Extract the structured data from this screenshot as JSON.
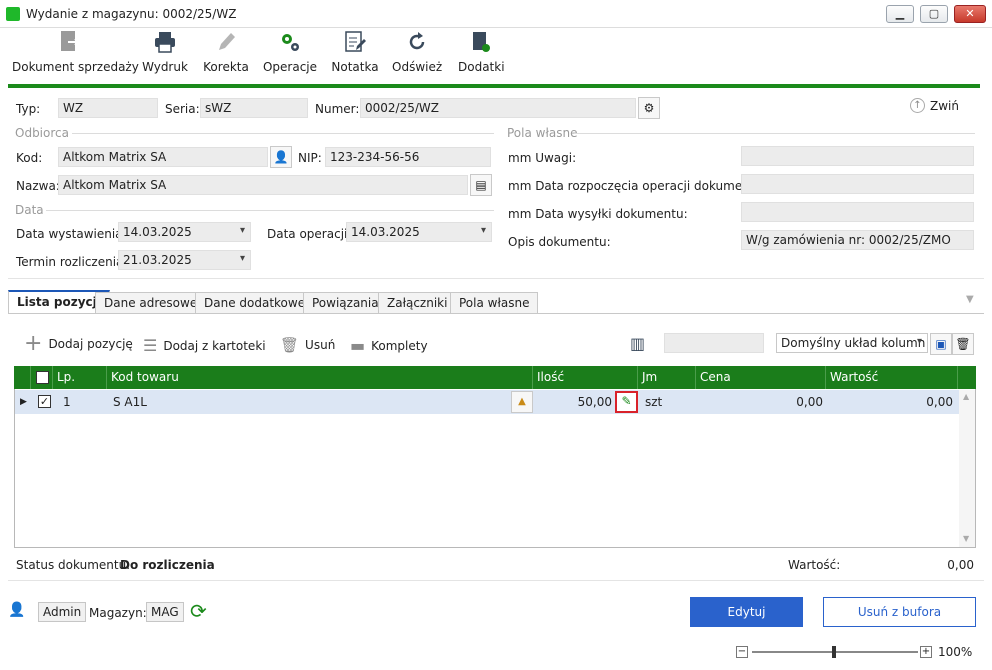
{
  "window": {
    "title": "Wydanie z magazynu: 0002/25/WZ"
  },
  "toolbar": {
    "items": [
      {
        "label": "Dokument sprzedaży",
        "icon": "document-sale-icon"
      },
      {
        "label": "Wydruk",
        "icon": "printer-icon"
      },
      {
        "label": "Korekta",
        "icon": "pencil-icon"
      },
      {
        "label": "Operacje",
        "icon": "gears-icon"
      },
      {
        "label": "Notatka",
        "icon": "note-icon"
      },
      {
        "label": "Odśwież",
        "icon": "refresh-icon"
      },
      {
        "label": "Dodatki",
        "icon": "addons-icon"
      }
    ]
  },
  "header": {
    "typ_label": "Typ:",
    "typ_value": "WZ",
    "seria_label": "Seria:",
    "seria_value": "sWZ",
    "numer_label": "Numer:",
    "numer_value": "0002/25/WZ",
    "collapse_label": "Zwiń"
  },
  "odbiorca": {
    "section": "Odbiorca",
    "kod_label": "Kod:",
    "kod_value": "Altkom Matrix SA",
    "nip_label": "NIP:",
    "nip_value": "123-234-56-56",
    "nazwa_label": "Nazwa:",
    "nazwa_value": "Altkom Matrix SA"
  },
  "data": {
    "section": "Data",
    "wystawienia_label": "Data wystawienia:",
    "wystawienia_value": "14.03.2025",
    "operacji_label": "Data operacji:",
    "operacji_value": "14.03.2025",
    "termin_label": "Termin rozliczenia:",
    "termin_value": "21.03.2025"
  },
  "pola": {
    "section": "Pola własne",
    "uwagi_label": "mm Uwagi:",
    "uwagi_value": "",
    "rozpoczecia_label": "mm Data rozpoczęcia operacji dokumentu:",
    "rozpoczecia_value": "",
    "wysylki_label": "mm Data wysyłki dokumentu:",
    "wysylki_value": "",
    "opis_label": "Opis dokumentu:",
    "opis_value": "W/g zamówienia nr: 0002/25/ZMO"
  },
  "tabs": [
    {
      "label": "Lista pozycji"
    },
    {
      "label": "Dane adresowe"
    },
    {
      "label": "Dane dodatkowe"
    },
    {
      "label": "Powiązania"
    },
    {
      "label": "Załączniki"
    },
    {
      "label": "Pola własne"
    }
  ],
  "grid_toolbar": {
    "add_label": "Dodaj pozycję",
    "add_from_label": "Dodaj z kartoteki",
    "delete_label": "Usuń",
    "sets_label": "Komplety",
    "search_value": "",
    "layout_value": "Domyślny układ kolumn"
  },
  "grid": {
    "columns": [
      "Lp.",
      "Kod towaru",
      "Ilość",
      "Jm",
      "Cena",
      "Wartość"
    ],
    "rows": [
      {
        "lp": "1",
        "kod": "S A1L",
        "ilosc": "50,00",
        "jm": "szt",
        "cena": "0,00",
        "wartosc": "0,00"
      }
    ]
  },
  "status": {
    "label": "Status dokumentu:",
    "value": "Do rozliczenia",
    "wartosc_label": "Wartość:",
    "wartosc_value": "0,00"
  },
  "footer": {
    "user": "Admin",
    "magazyn_label": "Magazyn:",
    "magazyn_value": "MAG",
    "edit_label": "Edytuj",
    "remove_label": "Usuń z bufora",
    "zoom": "100%"
  },
  "colors": {
    "accent": "#1b7d1b",
    "primary": "#2a62cc",
    "tab_active": "#1c57b7"
  }
}
